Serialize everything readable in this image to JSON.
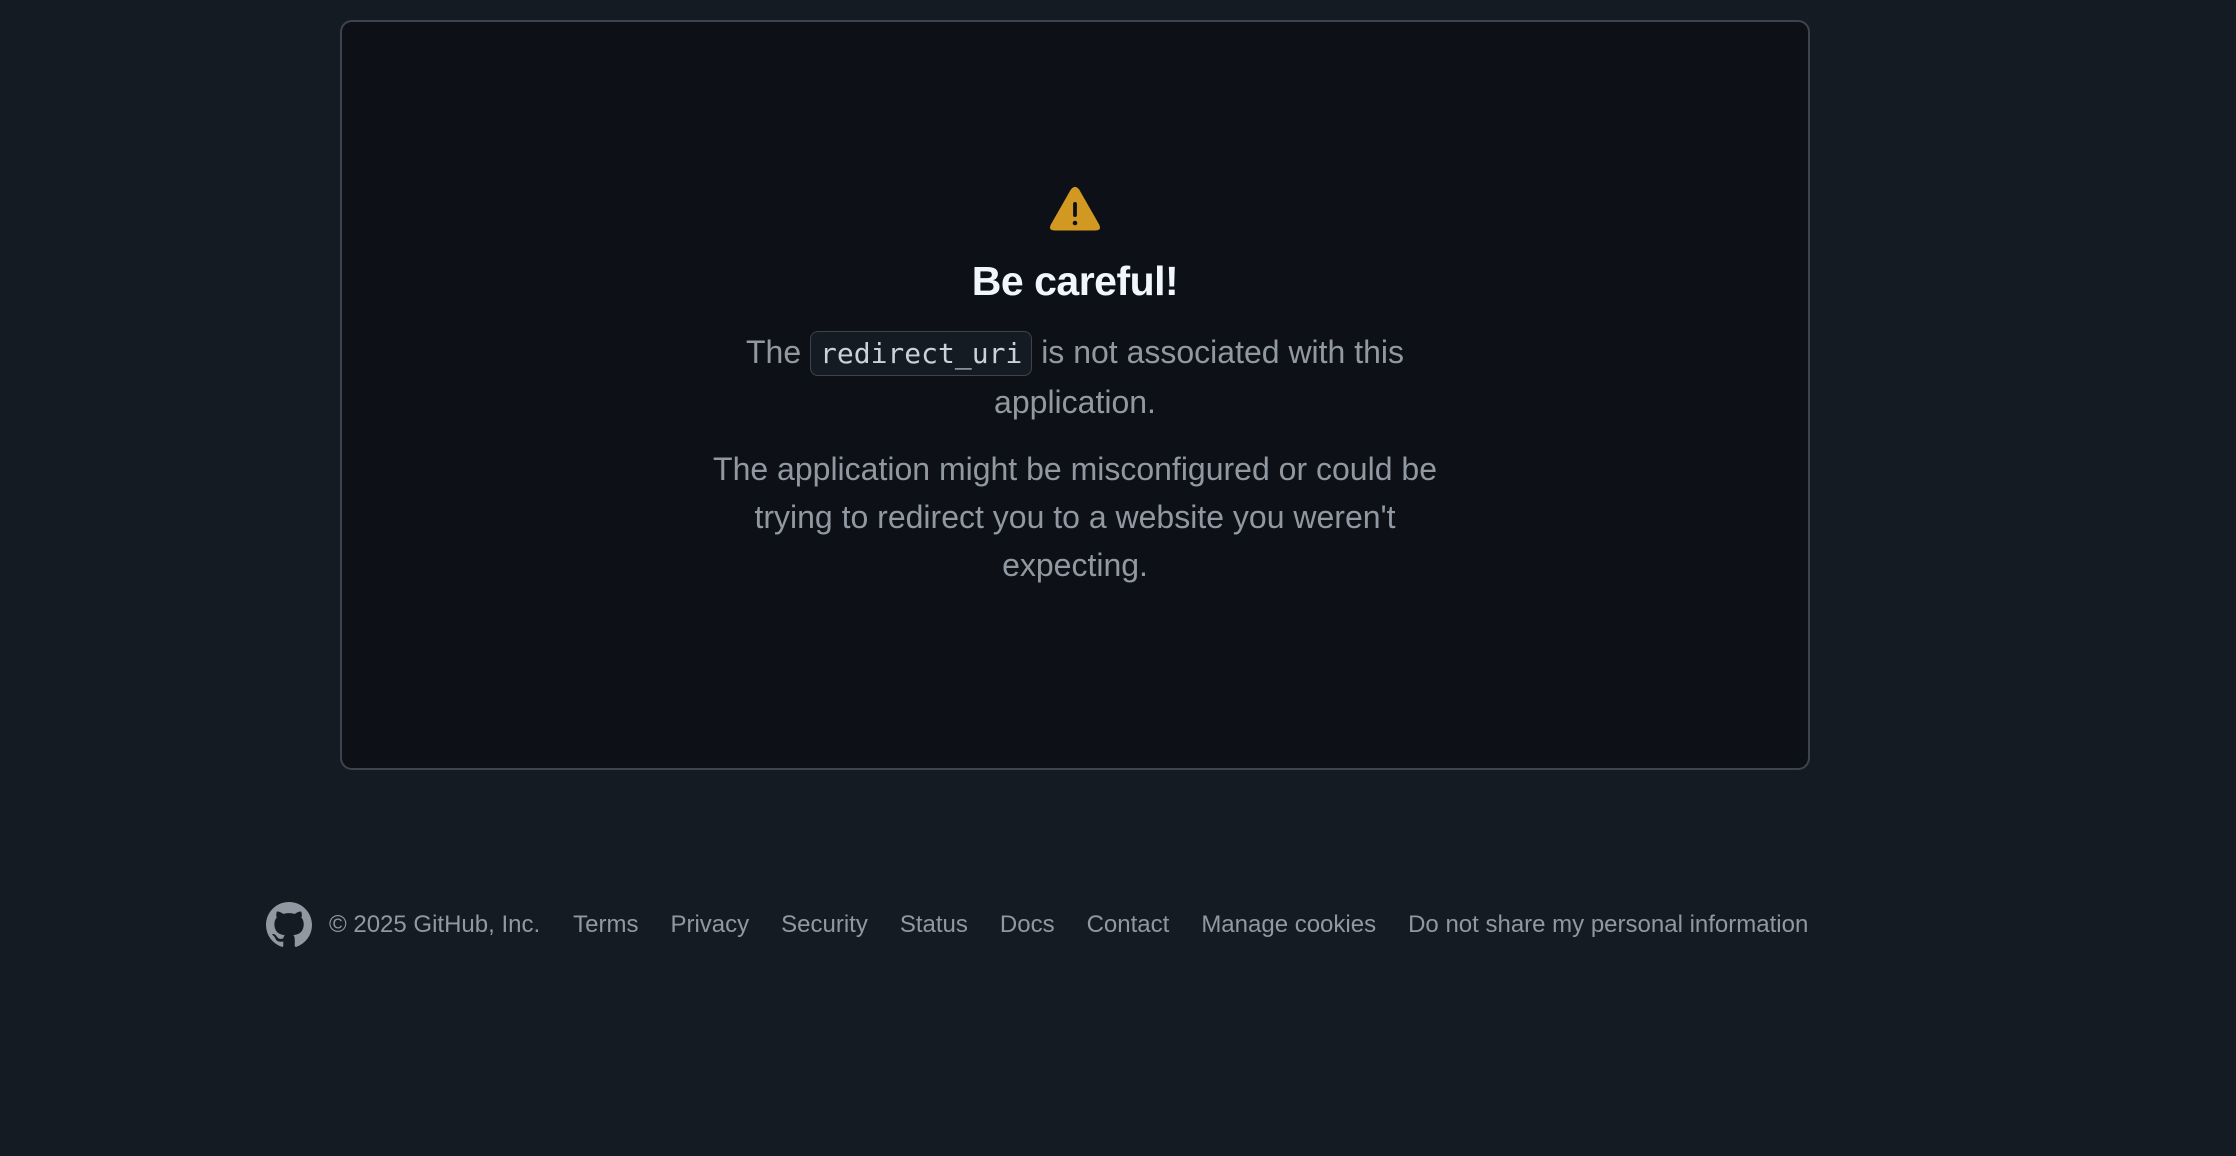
{
  "card": {
    "icon": "alert-triangle-icon",
    "icon_color": "#d29922",
    "title": "Be careful!",
    "message_prefix": "The",
    "code": "redirect_uri",
    "message_suffix": "is not associated with this application.",
    "detail": "The application might be misconfigured or could be trying to redirect you to a website you weren't expecting."
  },
  "footer": {
    "logo_icon": "github-mark-icon",
    "copyright": "© 2025 GitHub, Inc.",
    "links": [
      {
        "label": "Terms"
      },
      {
        "label": "Privacy"
      },
      {
        "label": "Security"
      },
      {
        "label": "Status"
      },
      {
        "label": "Docs"
      },
      {
        "label": "Contact"
      },
      {
        "label": "Manage cookies"
      },
      {
        "label": "Do not share my personal information"
      }
    ]
  },
  "colors": {
    "page_background": "#151b23",
    "card_background": "#0d1117",
    "border": "#3d444d",
    "title_text": "#f0f6fc",
    "muted_text": "#9198a1",
    "warning": "#d29922"
  }
}
